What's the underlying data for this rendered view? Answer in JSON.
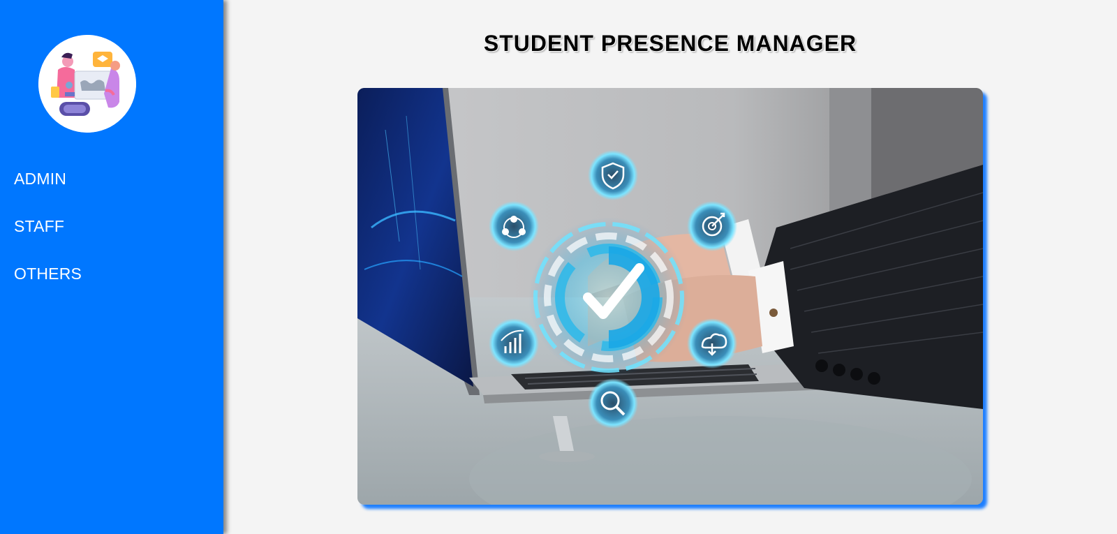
{
  "app": {
    "title": "STUDENT PRESENCE MANAGER"
  },
  "sidebar": {
    "logo_icon": "education-illustration-icon",
    "items": [
      {
        "label": "ADMIN"
      },
      {
        "label": "STAFF"
      },
      {
        "label": "OTHERS"
      }
    ]
  },
  "hero": {
    "icons": [
      "shield-check-icon",
      "target-icon",
      "cloud-download-icon",
      "search-analytics-icon",
      "growth-chart-icon",
      "team-network-icon",
      "checkmark-icon"
    ]
  },
  "colors": {
    "sidebar": "#0077ff",
    "background": "#f4f4f4",
    "accent_glow": "#37d0ff"
  }
}
